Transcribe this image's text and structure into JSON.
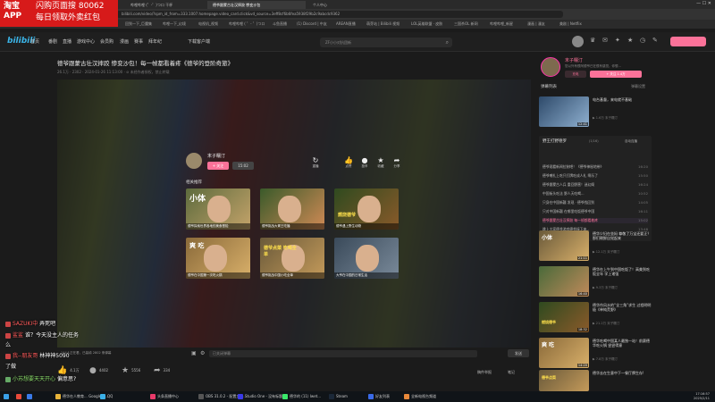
{
  "browser": {
    "tabs": [
      {
        "label": "哔哩哔哩 (゜-゜)つロ 干杯",
        "active": false
      },
      {
        "label": "德爷跟蒙古壮汉摔跤 惨变沙包",
        "active": true
      },
      {
        "label": "个人中心",
        "active": false
      }
    ],
    "url": "bilibili.com/video/?spm_id_from=333.1007.homepage.video_card.click&vd_source=3eff8cf6b6fea5938f29b2c9abcdc9362",
    "bookmarks": [
      "回到一下_巨魔集",
      "哔哩一下_幻境",
      "电视机_视频",
      "哔哩哔哩 ( ゜- ゜)つロ",
      "斗鱼直播",
      "(1) Discord | 中友",
      "AREAN直播",
      "萌芽站 | Bilibili 视频",
      "LOL英雄联盟 · 皮肤",
      "三国杀OL 新网",
      "哔哩哔哩_新星",
      "漫画 | 漫友",
      "美剧 | Netflix"
    ],
    "window_controls": "— ☐ ✕"
  },
  "taobao_ad": {
    "brand": "淘宝APP",
    "line1": "闪购页面搜 80062",
    "line2": "每日领取外卖红包"
  },
  "site": {
    "logo": "bilibili",
    "nav": [
      "首页",
      "番剧",
      "直播",
      "游戏中心",
      "会员购",
      "漫画",
      "赛事",
      "拜年纪",
      "下载客户端"
    ],
    "search_placeholder": "ZF小小对抗团新",
    "search_icon": "search-icon"
  },
  "video": {
    "title": "德爷跟蒙古壮汉摔跤 惨变沙包！每一帧都看着疼《德爷的登阶奇旅》",
    "meta": "26.1万  ·  2302  ·  2024-01-26 11:13:00  ·  ⊘ 未经作者授权，禁止转载",
    "up_name": "末子糯汀",
    "follow_label": "+ 关注",
    "time_pill": "15:02",
    "player_actions": [
      {
        "icon": "↻",
        "label": "重播"
      },
      {
        "icon": "👍",
        "label": "点赞"
      },
      {
        "icon": "●",
        "label": "投币"
      },
      {
        "icon": "★",
        "label": "收藏"
      },
      {
        "icon": "➦",
        "label": "分享"
      }
    ],
    "related_title": "相关推荐",
    "related": [
      {
        "caption": "德爷探索世界各地的美食冒险",
        "tag": "小体"
      },
      {
        "caption": "德爷挑战大胃王吃播",
        "tag": ""
      },
      {
        "caption": "德爷遇上野生动物",
        "tag": "燃烧德爷"
      },
      {
        "caption": "德爷在中国第一次吃火锅",
        "tag": "爽 吃"
      },
      {
        "caption": "德爷挑战中国小吃全单",
        "tag": "德爷点菜 吃喝全单"
      },
      {
        "caption": "大爷在中国的日常生活",
        "tag": ""
      }
    ]
  },
  "controls": {
    "viewers": "144人正在看，已装填 2802 条弹幕",
    "danmaku_placeholder": "已关闭弹幕",
    "send_label": "发送"
  },
  "actions": [
    {
      "icon": "👍",
      "value": "4.1万"
    },
    {
      "icon": "●",
      "value": "4402"
    },
    {
      "icon": "★",
      "value": "5556"
    },
    {
      "icon": "➦",
      "value": "334"
    }
  ],
  "actions_right": [
    "稿件举报",
    "笔记"
  ],
  "chat": [
    {
      "user": "SAZUKI中",
      "text": "弄死吧",
      "color": "red"
    },
    {
      "user": "鲨鲨",
      "text": "谁？今天没主人的任务",
      "color": "red"
    },
    {
      "user": "么",
      "text": "",
      "color": "white"
    },
    {
      "user": "我--朋友哥",
      "text": "林神神5090",
      "color": "red"
    },
    {
      "user": "了做",
      "text": "",
      "color": "white"
    },
    {
      "user": "小苏想要天天开心",
      "text": "偏意思?",
      "color": "green"
    }
  ],
  "right": {
    "up_name": "末子糯汀",
    "up_desc": "您以外有很阿德爷已在很有感觉，你想...",
    "charge_label": "充电",
    "follow_label": "+ 关注 1.4万",
    "list_head": "弹幕列表",
    "list_head_right": "弹幕设置",
    "top_video": {
      "title": "电台基督，来电就不基础",
      "meta": "▶ 1.6万  末子糯汀",
      "duration": "12:41"
    },
    "playlist_title": "野王打野德罗",
    "playlist_count": "(1/16)",
    "playlist_auto": "自动连播",
    "playlist": [
      {
        "title": "德爷观看新闻拉制吧！《德爷神秘地带》",
        "dur": "16:20",
        "active": false
      },
      {
        "title": "德爷嘲扎上吃只打牌吃成人礼 啊乐了",
        "dur": "15:50",
        "active": false
      },
      {
        "title": "德爷跟蒙古人兵 重回野营！迷幻阁",
        "dur": "16:24",
        "active": false
      },
      {
        "title": "中国街头吃法 野人天吃喝...",
        "dur": "10:52",
        "active": false
      },
      {
        "title": "只身在中国新疆 发现 · 德爷找回到",
        "dur": "14:05",
        "active": false
      },
      {
        "title": "只对中国新疆 在哪里吃饭德爷中国",
        "dur": "16:11",
        "active": false
      },
      {
        "title": "德爷跟蒙古壮汉摔跤 每一帧都看着疼",
        "dur": "15:02",
        "active": true
      },
      {
        "title": "跳上大家德爷游戏德爷接下来..",
        "dur": "13:48",
        "active": false
      }
    ],
    "videos": [
      {
        "title": "德华少妇在坐妈 尊敬了万宝还要正？那们朝鲜自觉起来",
        "meta": "▶ 12.1万  末子糯汀",
        "duration": "21:11",
        "tag": "小体"
      },
      {
        "title": "德华在上午到中国吃饭了！高美到吃饭全年 学上诸强",
        "meta": "▶ 9.3万  末子糯汀",
        "duration": "16:40",
        "tag": ""
      },
      {
        "title": "德华作风水的“全三角”求生 过程明明极《单纯荒野》",
        "meta": "▶ 21.2万  末子糯汀",
        "duration": "18:32",
        "tag": "燃烧德爷"
      },
      {
        "title": "德华吃喝中国某人最独一站！前赛德华吃火锅 尝尝得意",
        "meta": "▶ 7.8万  末子糯汀",
        "duration": "14:20",
        "tag": "爽 吃"
      },
      {
        "title": "德华去在生意中下一餐厅牌生存!",
        "meta": "▶ 5.5万  末子糯汀",
        "duration": "11:09",
        "tag": "德爷点菜"
      }
    ]
  },
  "taskbar": {
    "items": [
      "",
      "",
      "",
      "德华在人教育... Google C...",
      "QQ",
      "头条直播中心",
      "OBS 31.0.2 - 配置文件...",
      "Studio One - 没有标题",
      "德华的 (11) Iwet...",
      "Steam",
      "好友列表",
      "全新电视台频道"
    ],
    "clock_time": "17:16:57",
    "clock_date": "2025/2/11"
  },
  "colors": {
    "accent_pink": "#fb7299",
    "logo_blue": "#3bb5e8",
    "taobao_red": "#d71a1a"
  }
}
